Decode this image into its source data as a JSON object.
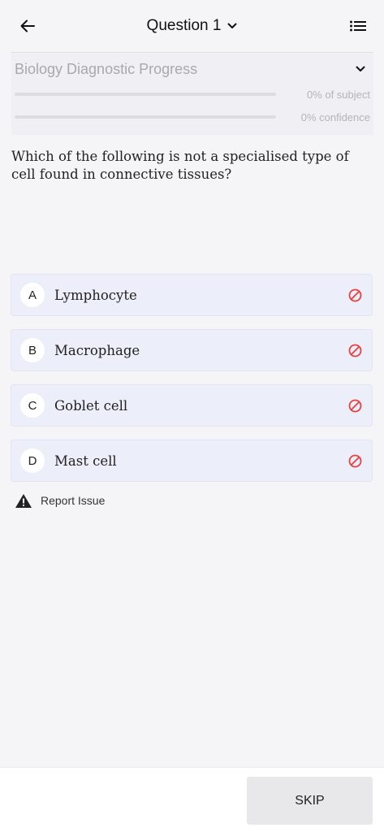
{
  "header": {
    "title": "Question 1",
    "back_icon": "arrow-left-icon",
    "dropdown_icon": "chevron-down-icon",
    "menu_icon": "list-icon"
  },
  "progress": {
    "title": "Biology Diagnostic Progress",
    "subject": {
      "label": "0% of subject",
      "value": 0
    },
    "confidence": {
      "label": "0% confidence",
      "value": 0
    }
  },
  "question": {
    "text": "Which of the following is not a specialised type of cell found in connective tissues?"
  },
  "options": [
    {
      "letter": "A",
      "text": "Lymphocyte"
    },
    {
      "letter": "B",
      "text": "Macrophage"
    },
    {
      "letter": "C",
      "text": "Goblet cell"
    },
    {
      "letter": "D",
      "text": "Mast cell"
    }
  ],
  "report": {
    "label": "Report Issue"
  },
  "footer": {
    "skip_label": "SKIP"
  },
  "colors": {
    "eliminate_icon": "#e8423f",
    "option_bg": "#eceef9",
    "page_bg": "#f5f5f8"
  }
}
